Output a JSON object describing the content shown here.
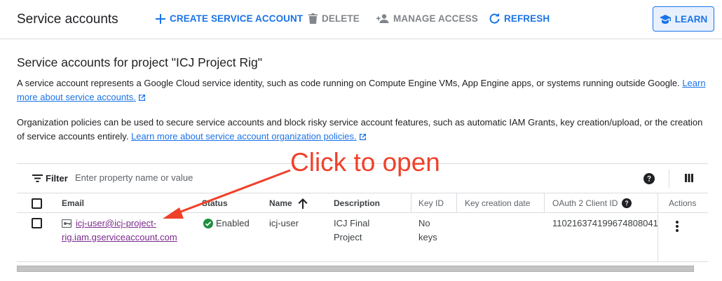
{
  "toolbar": {
    "title": "Service accounts",
    "create_label": "CREATE SERVICE ACCOUNT",
    "delete_label": "DELETE",
    "manage_access_label": "MANAGE ACCESS",
    "refresh_label": "REFRESH",
    "learn_label": "LEARN"
  },
  "content": {
    "heading": "Service accounts for project \"ICJ Project Rig\"",
    "intro_text": "A service account represents a Google Cloud service identity, such as code running on Compute Engine VMs, App Engine apps, or systems running outside Google. ",
    "intro_link": "Learn more about service accounts.",
    "policy_text": "Organization policies can be used to secure service accounts and block risky service account features, such as automatic IAM Grants, key creation/upload, or the creation of service accounts entirely. ",
    "policy_link": "Learn more about service account organization policies."
  },
  "filter": {
    "label": "Filter",
    "placeholder": "Enter property name or value"
  },
  "table": {
    "columns": {
      "email": "Email",
      "status": "Status",
      "name": "Name",
      "description": "Description",
      "key_id": "Key ID",
      "key_creation_date": "Key creation date",
      "oauth_client_id": "OAuth 2 Client ID",
      "actions": "Actions"
    },
    "rows": [
      {
        "email_line1": "icj-user@icj-project-",
        "email_line2": "rig.iam.gserviceaccount.com",
        "status": "Enabled",
        "name": "icj-user",
        "description_line1": "ICJ Final",
        "description_line2": "Project",
        "key_id_line1": "No",
        "key_id_line2": "keys",
        "key_creation_date": "",
        "oauth_client_id": "110216374199674808041"
      }
    ]
  },
  "annotation": {
    "text": "Click to open",
    "color": "#f0412a"
  },
  "colors": {
    "accent": "#1a73e8",
    "visited_link": "#7b2a8c",
    "status_enabled": "#1e8e3e"
  }
}
